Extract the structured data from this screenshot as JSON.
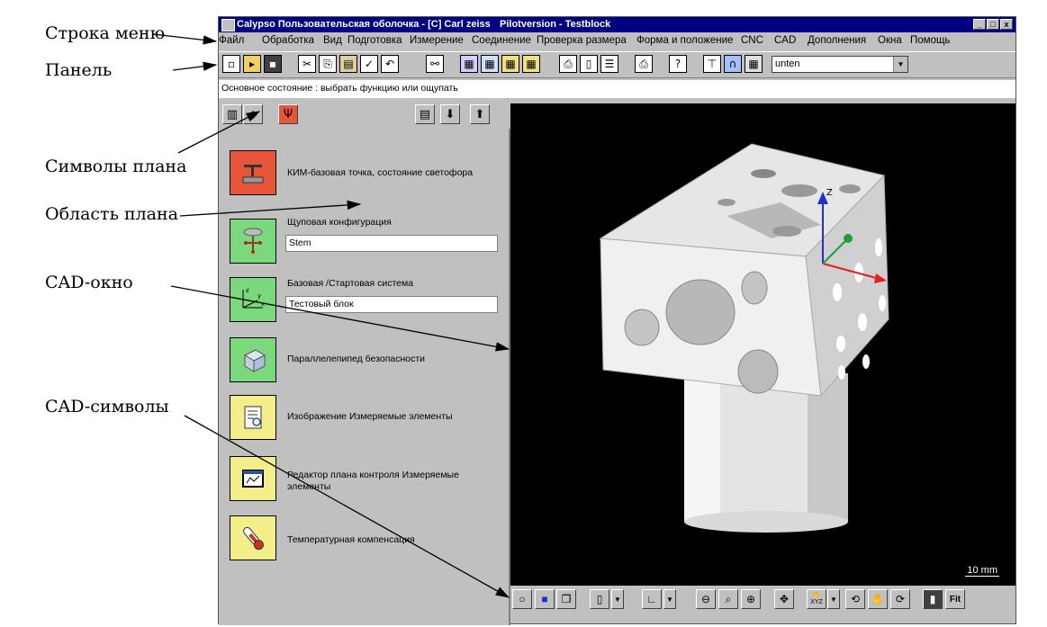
{
  "annotations": {
    "menu_bar": "Строка меню",
    "panel": "Панель",
    "plan_symbols": "Символы плана",
    "plan_area": "Область плана",
    "cad_window": "CAD-окно",
    "cad_symbols": "CAD-символы"
  },
  "window": {
    "title": "Calypso Пользовательская оболочка - [C] Carl zeiss",
    "subtitle": "Pilotversion - Testblock",
    "buttons": [
      "_",
      "□",
      "x"
    ]
  },
  "menu": [
    "Файл",
    "Обработка",
    "Вид",
    "Подготовка",
    "Измерение",
    "Соединение",
    "Проверка размера",
    "Форма и положение",
    "CNC",
    "CAD",
    "Дополнения",
    "Окна",
    "Помощь"
  ],
  "toolbar": {
    "icons": [
      "new-icon",
      "open-icon",
      "save-icon",
      "cut-icon",
      "copy-icon",
      "paste-icon",
      "edit-icon",
      "undo-icon",
      "binoculars-icon",
      "report-icon",
      "report2-icon",
      "report3-icon",
      "report4-icon",
      "print-icon",
      "delete-icon",
      "list-icon",
      "printer-icon",
      "help-icon",
      "probe-icon",
      "magnet-icon",
      "grid-icon"
    ],
    "select_value": "unten"
  },
  "status": "Основное состояние : выбрать функцию или ощупать",
  "plan_items": [
    {
      "label": "КИМ-базовая точка, состояние светофора",
      "field": null,
      "color": "#e8563a",
      "icon": "cmm-icon"
    },
    {
      "label": "Щуповая конфигурация",
      "field": "Stem",
      "color": "#7cd87c",
      "icon": "probe-config-icon"
    },
    {
      "label": "Базовая /Стартовая система",
      "field": "Тестовый блок",
      "color": "#7cd87c",
      "icon": "coordinate-system-icon"
    },
    {
      "label": "Параллелепипед безопасности",
      "field": null,
      "color": "#7cd87c",
      "icon": "safety-box-icon"
    },
    {
      "label": "Изображение Измеряемые элементы",
      "field": null,
      "color": "#f2ee8a",
      "icon": "display-elements-icon"
    },
    {
      "label": "Редактор плана контроля Измеряемые элементы",
      "field": null,
      "color": "#f2ee8a",
      "icon": "plan-editor-icon"
    },
    {
      "label": "Температурная компенсация",
      "field": null,
      "color": "#f2ee8a",
      "icon": "thermometer-icon"
    }
  ],
  "cad": {
    "scale_label": "10 mm",
    "axis_label": "Z",
    "fit_label": "Fit",
    "xyz_label": "XYZ"
  }
}
